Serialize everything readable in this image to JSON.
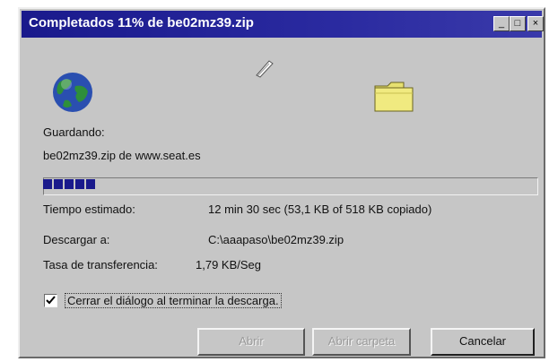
{
  "window": {
    "title": "Completados 11% de be02mz39.zip",
    "controls": {
      "minimize": "_",
      "maximize": "□",
      "close": "×"
    }
  },
  "icons": {
    "source": "globe-icon",
    "transfer": "paper-sheet-icon",
    "destination": "folder-icon"
  },
  "status": {
    "saving_label": "Guardando:",
    "saving_value": "be02mz39.zip de www.seat.es",
    "progress_fraction": 0.11
  },
  "details": {
    "time_label": "Tiempo estimado:",
    "time_value": "12 min 30 sec (53,1 KB of 518 KB copiado)",
    "download_label": "Descargar a:",
    "download_value": "C:\\aaapaso\\be02mz39.zip",
    "rate_label": "Tasa de transferencia:",
    "rate_value": "1,79 KB/Seg"
  },
  "options": {
    "close_on_finish_label": "Cerrar el diálogo al terminar la descarga.",
    "close_on_finish_checked": true
  },
  "buttons": {
    "open": "Abrir",
    "open_folder": "Abrir carpeta",
    "cancel": "Cancelar"
  },
  "colors": {
    "titlebar": "#1a1a8c",
    "face": "#c6c6c6",
    "progress": "#1a1a8c"
  }
}
